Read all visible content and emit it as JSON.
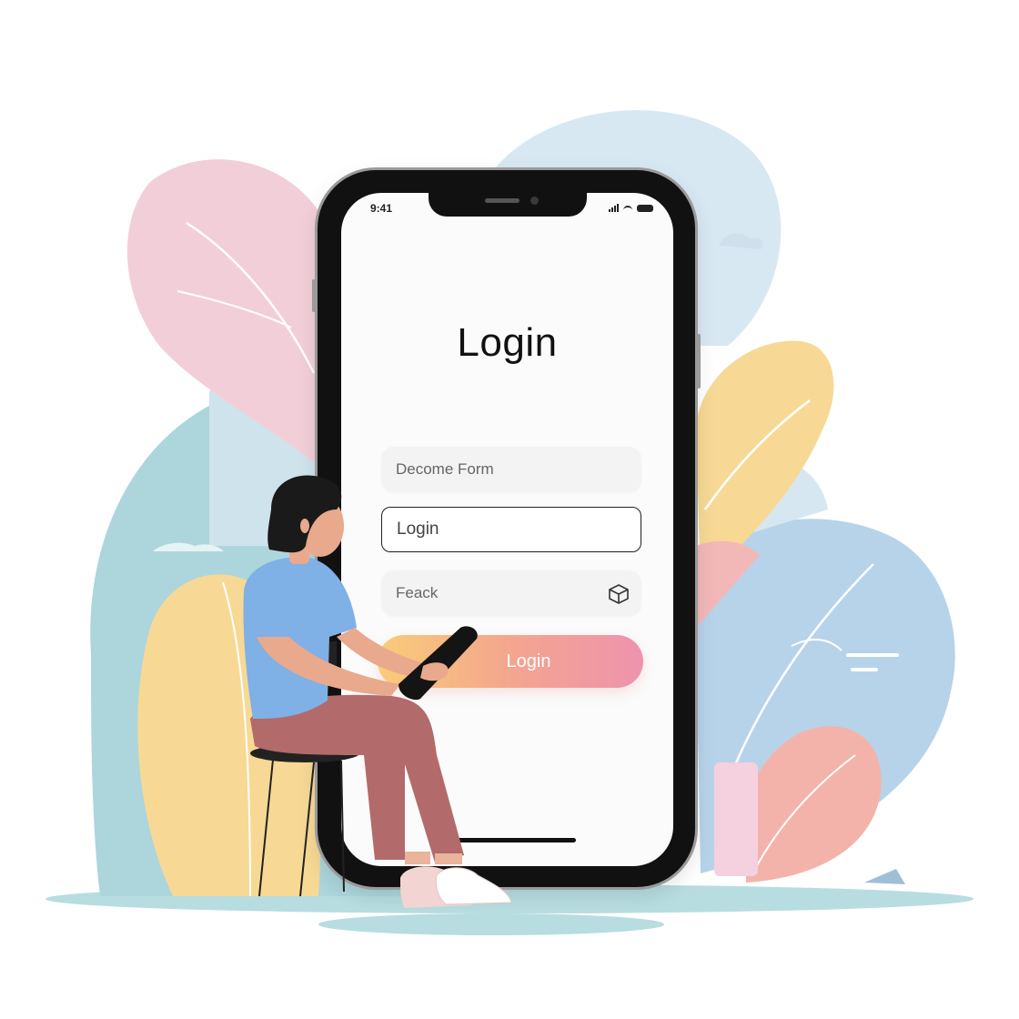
{
  "status_bar": {
    "time": "9:41"
  },
  "login_screen": {
    "title": "Login",
    "fields": [
      {
        "placeholder": "Decome Form"
      },
      {
        "placeholder": "Login"
      },
      {
        "placeholder": "Feack",
        "icon": "box-icon"
      }
    ],
    "submit_label": "Login"
  },
  "colors": {
    "button_gradient": [
      "#f8cd78",
      "#f4a58e",
      "#ee93ae"
    ],
    "leaf_pink": "#f2cfd8",
    "leaf_yellow": "#f7d995",
    "leaf_blue": "#b7d3ea",
    "blob_teal": "#acd6dc",
    "shirt_blue": "#7fb0e6",
    "pants_mauve": "#b36a6a"
  }
}
